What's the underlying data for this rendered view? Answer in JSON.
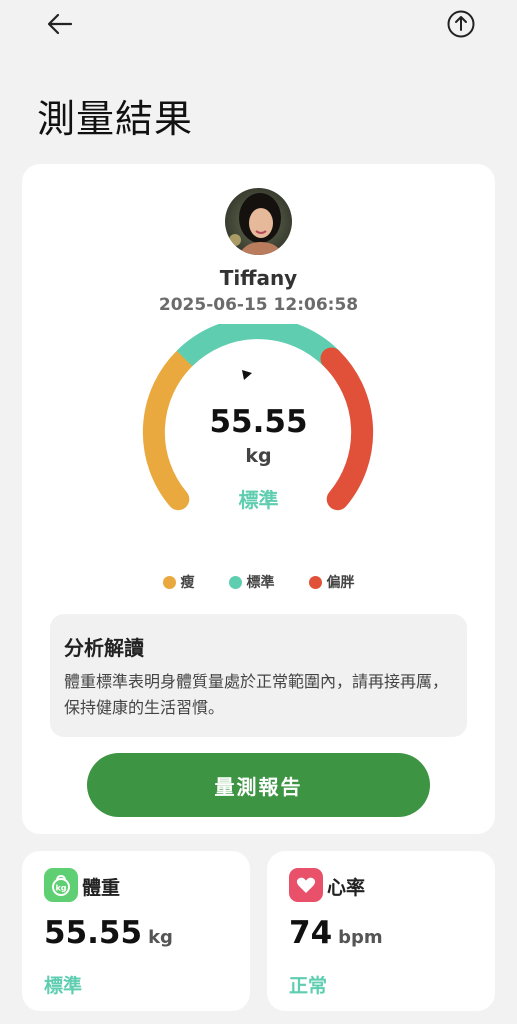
{
  "header": {
    "back_icon": "back-arrow-icon",
    "share_icon": "share-upload-icon",
    "title": "測量結果"
  },
  "profile": {
    "name": "Tiffany",
    "timestamp": "2025-06-15 12:06:58"
  },
  "gauge": {
    "value": "55.55",
    "unit": "kg",
    "status": "標準",
    "segments": [
      {
        "label": "瘦",
        "color": "#e9a93f"
      },
      {
        "label": "標準",
        "color": "#5ecdb0"
      },
      {
        "label": "偏胖",
        "color": "#e15139"
      }
    ]
  },
  "analysis": {
    "title": "分析解讀",
    "text": "體重標準表明身體質量處於正常範圍內，請再接再厲，保持健康的生活習慣。"
  },
  "report_button": "量測報告",
  "metrics": {
    "weight": {
      "icon": "kettlebell-kg-icon",
      "icon_text": "kg",
      "label": "體重",
      "value": "55.55",
      "unit": "kg",
      "status": "標準",
      "color": "#5ecf72"
    },
    "heart": {
      "icon": "heart-icon",
      "label": "心率",
      "value": "74",
      "unit": "bpm",
      "status": "正常",
      "color": "#e9506a"
    }
  }
}
